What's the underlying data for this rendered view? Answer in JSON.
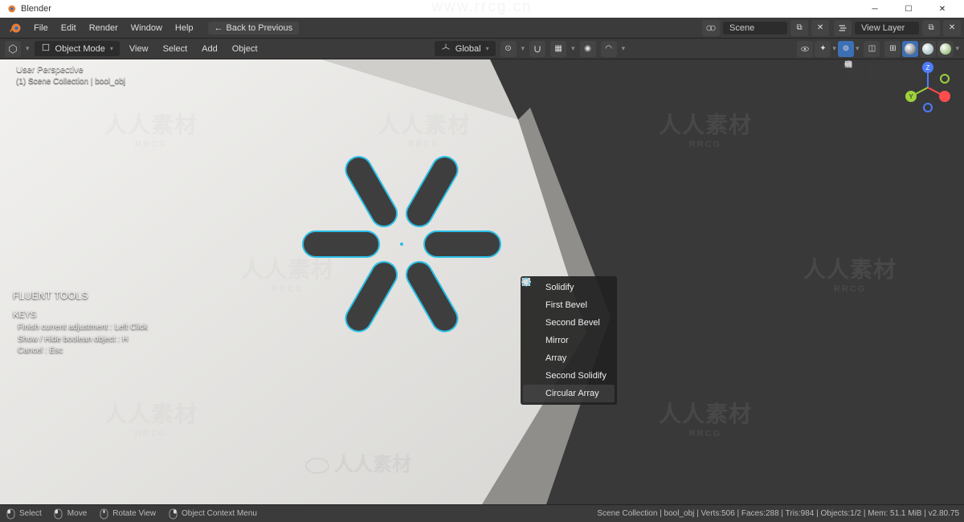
{
  "titlebar": {
    "app_name": "Blender"
  },
  "menu": {
    "items": [
      "File",
      "Edit",
      "Render",
      "Window",
      "Help"
    ],
    "back_label": "Back to Previous",
    "scene_label": "Scene",
    "viewlayer_label": "View Layer"
  },
  "header2": {
    "mode": "Object Mode",
    "items": [
      "View",
      "Select",
      "Add",
      "Object"
    ],
    "orientation": "Global"
  },
  "overlay": {
    "line1": "User Perspective",
    "line2": "(1) Scene Collection | bool_obj"
  },
  "fluent": {
    "title": "FLUENT TOOLS",
    "keys_heading": "KEYS",
    "lines": [
      "Finish current adjustment : Left Click",
      "Show / Hide boolean object : H",
      "Cancel : Esc"
    ]
  },
  "popup": {
    "items": [
      {
        "label": "Solidify",
        "icon": "solidify"
      },
      {
        "label": "First Bevel",
        "icon": "first-bevel"
      },
      {
        "label": "Second Bevel",
        "icon": "second-bevel"
      },
      {
        "label": "Mirror",
        "icon": "mirror"
      },
      {
        "label": "Array",
        "icon": "array"
      },
      {
        "label": "Second Solidify",
        "icon": "second-solidify"
      },
      {
        "label": "Circular Array",
        "icon": "circular-array"
      }
    ]
  },
  "statusbar": {
    "select": "Select",
    "move": "Move",
    "rotate": "Rotate View",
    "context": "Object Context Menu",
    "stats": "Scene Collection | bool_obj | Verts:506 | Faces:288 | Tris:984 | Objects:1/2 | Mem: 51.1 MiB | v2.80.75"
  },
  "watermark": {
    "url": "www.rrcg.cn",
    "big": "人人素材",
    "sub": "RRCG"
  }
}
